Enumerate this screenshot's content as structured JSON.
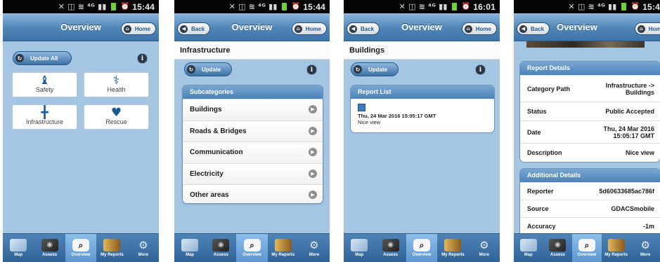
{
  "screens": [
    {
      "status_time": "15:44",
      "header_title": "Overview",
      "home_label": "Home",
      "update_all_label": "Update All",
      "tiles": [
        {
          "label": "Safety",
          "icon": "person-icon"
        },
        {
          "label": "Health",
          "icon": "caduceus-icon"
        },
        {
          "label": "Infrastructure",
          "icon": "signpost-icon"
        },
        {
          "label": "Rescue",
          "icon": "rescue-hands-icon"
        }
      ]
    },
    {
      "status_time": "15:44",
      "back_label": "Back",
      "header_title": "Overview",
      "home_label": "Home",
      "page_title": "Infrastructure",
      "update_label": "Update",
      "list_header": "Subcategories",
      "items": [
        "Buildings",
        "Roads & Bridges",
        "Communication",
        "Electricity",
        "Other areas"
      ]
    },
    {
      "status_time": "16:01",
      "back_label": "Back",
      "header_title": "Overview",
      "home_label": "Home",
      "page_title": "Buildings",
      "update_label": "Update",
      "list_header": "Report List",
      "report_date": "Thu, 24 Mar 2016 15:05:17 GMT",
      "report_desc": "Nice view"
    },
    {
      "status_time": "15:4",
      "back_label": "Back",
      "header_title": "Overview",
      "home_label": "Home",
      "report_details_header": "Report Details",
      "report_details": [
        {
          "key": "Category Path",
          "value": "Infrastructure -> Buildings"
        },
        {
          "key": "Status",
          "value": "Public Accepted"
        },
        {
          "key": "Date",
          "value": "Thu, 24 Mar 2016 15:05:17 GMT"
        },
        {
          "key": "Description",
          "value": "Nice view"
        }
      ],
      "additional_header": "Additional Details",
      "additional_details": [
        {
          "key": "Reporter",
          "value": "5d60633685ac786f"
        },
        {
          "key": "Source",
          "value": "GDACSmobile"
        },
        {
          "key": "Accuracy",
          "value": "-1m"
        }
      ]
    }
  ],
  "tabbar": [
    {
      "label": "Map",
      "icon": "map-icon"
    },
    {
      "label": "Assess",
      "icon": "camera-icon"
    },
    {
      "label": "Overview",
      "icon": "magnifier-icon"
    },
    {
      "label": "My Reports",
      "icon": "folders-icon"
    },
    {
      "label": "More",
      "icon": "gear-icon"
    }
  ],
  "colors": {
    "header": "#4f85b6",
    "background": "#a4c6e3",
    "statusbar": "#050505",
    "battery": "#6ed23a"
  }
}
